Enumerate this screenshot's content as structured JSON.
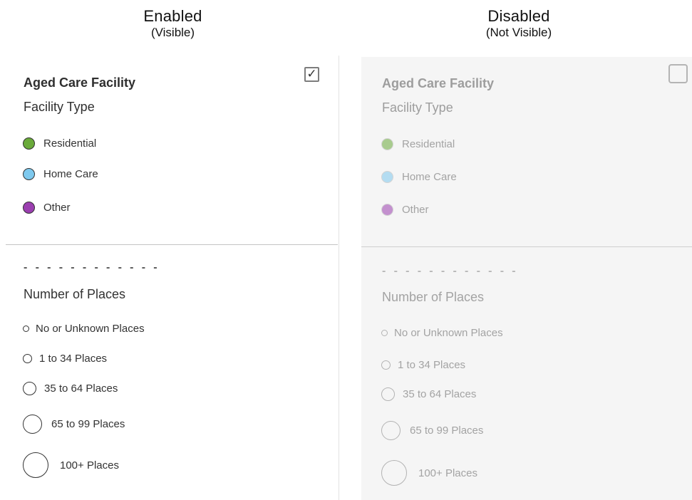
{
  "columns": {
    "enabled": {
      "title": "Enabled",
      "subtitle": "(Visible)"
    },
    "disabled": {
      "title": "Disabled",
      "subtitle": "(Not Visible)"
    }
  },
  "legend": {
    "title": "Aged Care Facility",
    "facility_type_label": "Facility Type",
    "facility_types": [
      {
        "label": "Residential",
        "color": "#6aaa3a",
        "icon": "green-dot-icon"
      },
      {
        "label": "Home Care",
        "color": "#7ec9ee",
        "icon": "light-blue-dot-icon"
      },
      {
        "label": "Other",
        "color": "#9b3fb0",
        "icon": "purple-dot-icon"
      }
    ],
    "separator_dashes": "- - - - - - - - - - - -",
    "places_label": "Number of Places",
    "places": [
      {
        "label": "No or Unknown Places",
        "icon": "tiny-circle-icon"
      },
      {
        "label": "1 to 34 Places",
        "icon": "small-circle-icon"
      },
      {
        "label": "35 to 64 Places",
        "icon": "medium-circle-icon"
      },
      {
        "label": "65 to 99 Places",
        "icon": "large-circle-icon"
      },
      {
        "label": "100+ Places",
        "icon": "xlarge-circle-icon"
      }
    ]
  },
  "visibility": {
    "enabled_checked": true,
    "enabled_mark": "✓",
    "disabled_checked": false,
    "disabled_mark": ""
  },
  "colors": {
    "disabled_background": "#f5f5f5",
    "enabled_text": "#333333",
    "disabled_text": "#a3a3a3"
  }
}
